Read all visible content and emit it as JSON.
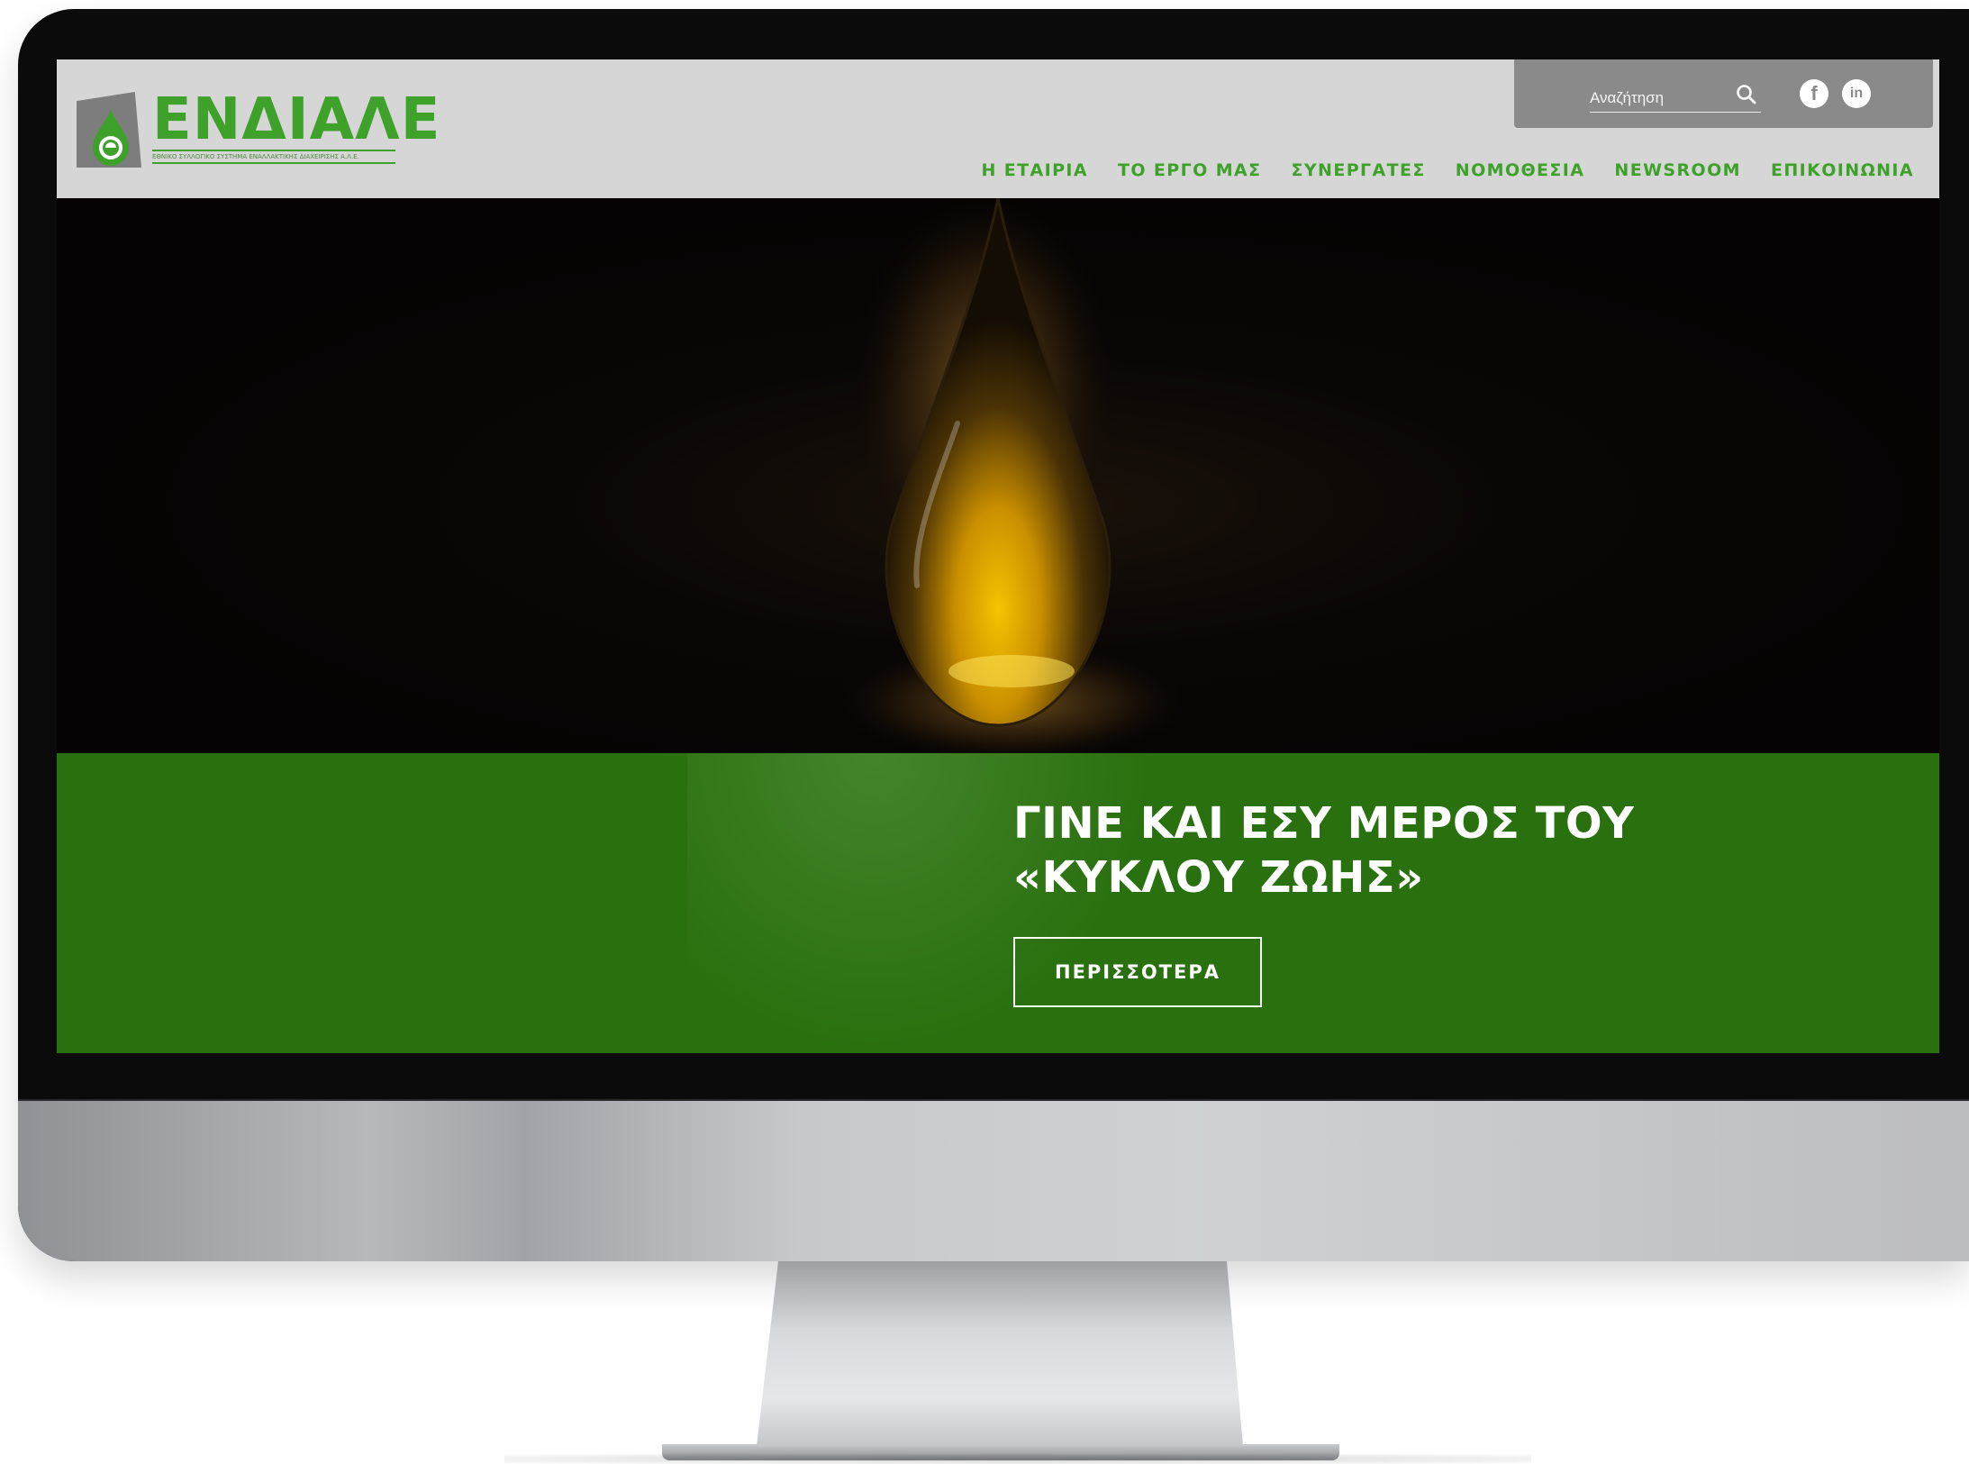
{
  "site": {
    "logo": {
      "title": "ΕΝΔΙΑΛΕ",
      "subtitle": "ΕΘΝΙΚΟ ΣΥΛΛΟΓΙΚΟ ΣΥΣΤΗΜΑ ΕΝΑΛΛΑΚΤΙΚΗΣ ΔΙΑΧΕΙΡΙΣΗΣ Α.Λ.Ε."
    },
    "search": {
      "placeholder": "Αναζήτηση",
      "icon": "search-icon"
    },
    "social": [
      {
        "name": "facebook",
        "glyph": "f"
      },
      {
        "name": "linkedin",
        "glyph": "in"
      }
    ],
    "nav": [
      {
        "label": "Η ΕΤΑΙΡΙΑ"
      },
      {
        "label": "ΤΟ ΕΡΓΟ ΜΑΣ"
      },
      {
        "label": "ΣΥΝΕΡΓΑΤΕΣ"
      },
      {
        "label": "ΝΟΜΟΘΕΣΙΑ"
      },
      {
        "label": "NEWSROOM"
      },
      {
        "label": "ΕΠΙΚΟΙΝΩΝΙΑ"
      }
    ],
    "hero": {
      "headline": "ΓΙΝΕ ΚΑΙ ΕΣΥ ΜΕΡΟΣ ΤΟΥ «ΚΥΚΛΟΥ ΖΩΗΣ»",
      "button": "ΠΕΡΙΣΣΟΤΕΡΑ"
    },
    "colors": {
      "brand_green": "#3ea12a",
      "band_green": "#29700f",
      "header_gray": "#d6d6d6",
      "topbar_gray": "#8a8a8a"
    }
  }
}
